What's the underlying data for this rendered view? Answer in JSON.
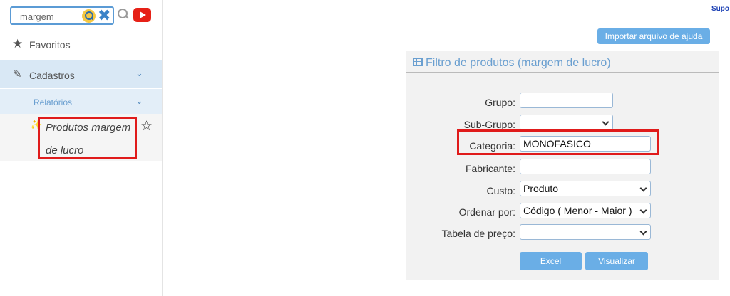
{
  "sidebar": {
    "search": {
      "value": "margem",
      "clear_glyph": "✖"
    },
    "favorites_label": "Favoritos",
    "cadastros_label": "Cadastros",
    "relatorios_label": "Relatórios",
    "active_item_label": "Produtos margem de lucro"
  },
  "header": {
    "support_text": "Supo",
    "import_button_label": "Importar arquivo de ajuda"
  },
  "panel": {
    "title": "Filtro de produtos (margem de lucro)",
    "fields": {
      "grupo": {
        "label": "Grupo:",
        "value": ""
      },
      "subgrupo": {
        "label": "Sub-Grupo:",
        "value": ""
      },
      "categoria": {
        "label": "Categoria:",
        "value": "MONOFASICO"
      },
      "fabricante": {
        "label": "Fabricante:",
        "value": ""
      },
      "custo": {
        "label": "Custo:",
        "value": "Produto"
      },
      "ordenar": {
        "label": "Ordenar por:",
        "value": "Código ( Menor - Maior )"
      },
      "tabela": {
        "label": "Tabela de preço:",
        "value": ""
      }
    },
    "buttons": {
      "excel": "Excel",
      "visualizar": "Visualizar"
    }
  },
  "colors": {
    "accent_blue": "#6aaee6",
    "highlight_red": "#e01b1b",
    "sidebar_active": "#d9e8f5",
    "youtube_red": "#e62117"
  },
  "icons": [
    "search-go-icon",
    "clear-icon",
    "magnifier-icon",
    "youtube-icon",
    "star-icon",
    "edit-icon",
    "chevron-down-icon",
    "sparkle-icon",
    "star-outline-icon",
    "grid-table-icon"
  ]
}
